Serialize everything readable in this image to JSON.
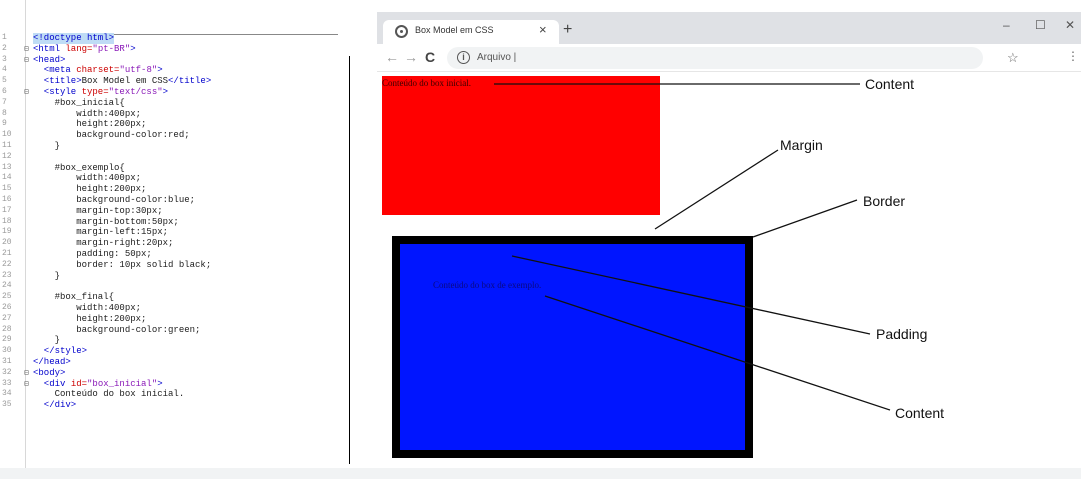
{
  "editor": {
    "lines": [
      {
        "n": "1",
        "fold": "",
        "segments": [
          {
            "t": "<!doctype html>",
            "c": "tag"
          }
        ],
        "highlight": true
      },
      {
        "n": "2",
        "fold": "⊟",
        "segments": [
          {
            "t": "<html ",
            "c": "tag"
          },
          {
            "t": "lang=",
            "c": "attr"
          },
          {
            "t": "\"pt-BR\"",
            "c": "val"
          },
          {
            "t": ">",
            "c": "tag"
          }
        ]
      },
      {
        "n": "3",
        "fold": "⊟",
        "segments": [
          {
            "t": "<head>",
            "c": "tag"
          }
        ]
      },
      {
        "n": "4",
        "fold": "",
        "segments": [
          {
            "t": "  <meta ",
            "c": "tag"
          },
          {
            "t": "charset=",
            "c": "attr"
          },
          {
            "t": "\"utf-8\"",
            "c": "val"
          },
          {
            "t": ">",
            "c": "tag"
          }
        ]
      },
      {
        "n": "5",
        "fold": "",
        "segments": [
          {
            "t": "  <title>",
            "c": "tag"
          },
          {
            "t": "Box Model em CSS",
            "c": "plain"
          },
          {
            "t": "</title>",
            "c": "tag"
          }
        ]
      },
      {
        "n": "6",
        "fold": "⊟",
        "segments": [
          {
            "t": "  <style ",
            "c": "tag"
          },
          {
            "t": "type=",
            "c": "attr"
          },
          {
            "t": "\"text/css\"",
            "c": "val"
          },
          {
            "t": ">",
            "c": "tag"
          }
        ]
      },
      {
        "n": "7",
        "fold": "",
        "segments": [
          {
            "t": "    #box_inicial{",
            "c": "plain"
          }
        ]
      },
      {
        "n": "8",
        "fold": "",
        "segments": [
          {
            "t": "        width:400px;",
            "c": "plain"
          }
        ]
      },
      {
        "n": "9",
        "fold": "",
        "segments": [
          {
            "t": "        height:200px;",
            "c": "plain"
          }
        ]
      },
      {
        "n": "10",
        "fold": "",
        "segments": [
          {
            "t": "        background-color:red;",
            "c": "plain"
          }
        ]
      },
      {
        "n": "11",
        "fold": "",
        "segments": [
          {
            "t": "    }",
            "c": "plain"
          }
        ]
      },
      {
        "n": "12",
        "fold": "",
        "segments": [
          {
            "t": "",
            "c": "plain"
          }
        ]
      },
      {
        "n": "13",
        "fold": "",
        "segments": [
          {
            "t": "    #box_exemplo{",
            "c": "plain"
          }
        ]
      },
      {
        "n": "14",
        "fold": "",
        "segments": [
          {
            "t": "        width:400px;",
            "c": "plain"
          }
        ]
      },
      {
        "n": "15",
        "fold": "",
        "segments": [
          {
            "t": "        height:200px;",
            "c": "plain"
          }
        ]
      },
      {
        "n": "16",
        "fold": "",
        "segments": [
          {
            "t": "        background-color:blue;",
            "c": "plain"
          }
        ]
      },
      {
        "n": "17",
        "fold": "",
        "segments": [
          {
            "t": "        margin-top:30px;",
            "c": "plain"
          }
        ]
      },
      {
        "n": "18",
        "fold": "",
        "segments": [
          {
            "t": "        margin-bottom:50px;",
            "c": "plain"
          }
        ]
      },
      {
        "n": "19",
        "fold": "",
        "segments": [
          {
            "t": "        margin-left:15px;",
            "c": "plain"
          }
        ]
      },
      {
        "n": "20",
        "fold": "",
        "segments": [
          {
            "t": "        margin-right:20px;",
            "c": "plain"
          }
        ]
      },
      {
        "n": "21",
        "fold": "",
        "segments": [
          {
            "t": "        padding: 50px;",
            "c": "plain"
          }
        ]
      },
      {
        "n": "22",
        "fold": "",
        "segments": [
          {
            "t": "        border: 10px solid black;",
            "c": "plain"
          }
        ]
      },
      {
        "n": "23",
        "fold": "",
        "segments": [
          {
            "t": "    }",
            "c": "plain"
          }
        ]
      },
      {
        "n": "24",
        "fold": "",
        "segments": [
          {
            "t": "",
            "c": "plain"
          }
        ]
      },
      {
        "n": "25",
        "fold": "",
        "segments": [
          {
            "t": "    #box_final{",
            "c": "plain"
          }
        ]
      },
      {
        "n": "26",
        "fold": "",
        "segments": [
          {
            "t": "        width:400px;",
            "c": "plain"
          }
        ]
      },
      {
        "n": "27",
        "fold": "",
        "segments": [
          {
            "t": "        height:200px;",
            "c": "plain"
          }
        ]
      },
      {
        "n": "28",
        "fold": "",
        "segments": [
          {
            "t": "        background-color:green;",
            "c": "plain"
          }
        ]
      },
      {
        "n": "29",
        "fold": "",
        "segments": [
          {
            "t": "    }",
            "c": "plain"
          }
        ]
      },
      {
        "n": "30",
        "fold": "",
        "segments": [
          {
            "t": "  </style>",
            "c": "tag"
          }
        ]
      },
      {
        "n": "31",
        "fold": "",
        "segments": [
          {
            "t": "</head>",
            "c": "tag"
          }
        ]
      },
      {
        "n": "32",
        "fold": "⊟",
        "segments": [
          {
            "t": "<body>",
            "c": "tag"
          }
        ]
      },
      {
        "n": "33",
        "fold": "⊟",
        "segments": [
          {
            "t": "  <div ",
            "c": "tag"
          },
          {
            "t": "id=",
            "c": "attr"
          },
          {
            "t": "\"box_inicial\"",
            "c": "val"
          },
          {
            "t": ">",
            "c": "tag"
          }
        ]
      },
      {
        "n": "34",
        "fold": "",
        "segments": [
          {
            "t": "    Conteúdo do box inicial.",
            "c": "plain"
          }
        ]
      },
      {
        "n": "35",
        "fold": "",
        "segments": [
          {
            "t": "  </div>",
            "c": "tag"
          }
        ]
      }
    ]
  },
  "browser": {
    "tab_title": "Box Model em CSS",
    "tab_close": "×",
    "new_tab": "+",
    "window_controls": {
      "minimize": "–",
      "maximize": "☐",
      "close": "✕"
    },
    "nav": {
      "back": "←",
      "forward": "→",
      "reload": "C"
    },
    "omnibox": {
      "info": "i",
      "label": "Arquivo |"
    },
    "star": "☆",
    "menu": "⋮"
  },
  "page": {
    "box_inicial_text": "Conteúdo do box inicial.",
    "box_exemplo_text": "Conteúdo do box de exemplo."
  },
  "annotations": {
    "content_top": "Content",
    "margin": "Margin",
    "border": "Border",
    "padding": "Padding",
    "content_bottom": "Content"
  },
  "colors": {
    "box_inicial": "#ff0000",
    "box_exemplo": "#0015ff",
    "border": "#000000"
  }
}
